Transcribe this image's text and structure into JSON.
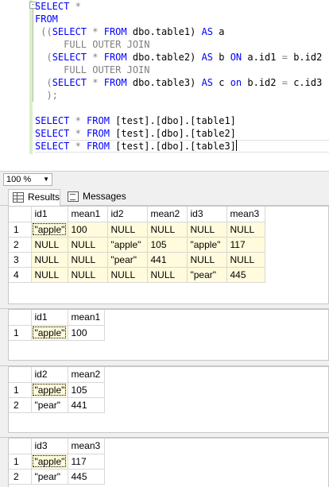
{
  "editor": {
    "lines": [
      [
        {
          "t": "SELECT",
          "c": "k"
        },
        {
          "t": " *",
          "c": "g"
        }
      ],
      [
        {
          "t": "FROM",
          "c": "k"
        }
      ],
      [
        {
          "t": " ((",
          "c": "g"
        },
        {
          "t": "SELECT",
          "c": "k"
        },
        {
          "t": " * ",
          "c": "g"
        },
        {
          "t": "FROM",
          "c": "k"
        },
        {
          "t": " dbo.table1) ",
          "c": ""
        },
        {
          "t": "AS",
          "c": "k"
        },
        {
          "t": " a",
          "c": ""
        }
      ],
      [
        {
          "t": "     ",
          "c": ""
        },
        {
          "t": "FULL OUTER JOIN",
          "c": "g"
        }
      ],
      [
        {
          "t": "  (",
          "c": "g"
        },
        {
          "t": "SELECT",
          "c": "k"
        },
        {
          "t": " * ",
          "c": "g"
        },
        {
          "t": "FROM",
          "c": "k"
        },
        {
          "t": " dbo.table2) ",
          "c": ""
        },
        {
          "t": "AS",
          "c": "k"
        },
        {
          "t": " b ",
          "c": ""
        },
        {
          "t": "ON",
          "c": "k"
        },
        {
          "t": " a.id1 ",
          "c": ""
        },
        {
          "t": "=",
          "c": "g"
        },
        {
          "t": " b.id2",
          "c": ""
        }
      ],
      [
        {
          "t": "     ",
          "c": ""
        },
        {
          "t": "FULL OUTER JOIN",
          "c": "g"
        }
      ],
      [
        {
          "t": "  (",
          "c": "g"
        },
        {
          "t": "SELECT",
          "c": "k"
        },
        {
          "t": " * ",
          "c": "g"
        },
        {
          "t": "FROM",
          "c": "k"
        },
        {
          "t": " dbo.table3) ",
          "c": ""
        },
        {
          "t": "AS",
          "c": "k"
        },
        {
          "t": " c ",
          "c": ""
        },
        {
          "t": "on",
          "c": "k"
        },
        {
          "t": " b.id2 ",
          "c": ""
        },
        {
          "t": "=",
          "c": "g"
        },
        {
          "t": " c.id3",
          "c": ""
        }
      ],
      [
        {
          "t": "  );",
          "c": "g"
        }
      ],
      [],
      [
        {
          "t": "SELECT",
          "c": "k"
        },
        {
          "t": " * ",
          "c": "g"
        },
        {
          "t": "FROM",
          "c": "k"
        },
        {
          "t": " [test].[dbo].[table1]",
          "c": ""
        }
      ],
      [
        {
          "t": "SELECT",
          "c": "k"
        },
        {
          "t": " * ",
          "c": "g"
        },
        {
          "t": "FROM",
          "c": "k"
        },
        {
          "t": " [test].[dbo].[table2]",
          "c": ""
        }
      ],
      [
        {
          "t": "SELECT",
          "c": "k"
        },
        {
          "t": " * ",
          "c": "g"
        },
        {
          "t": "FROM",
          "c": "k"
        },
        {
          "t": " [test].[dbo].[table3]",
          "c": ""
        }
      ]
    ],
    "fold_symbol": "-"
  },
  "zoom": {
    "value": "100 %"
  },
  "tabs": {
    "results": "Results",
    "messages": "Messages"
  },
  "grids": [
    {
      "columns": [
        "id1",
        "mean1",
        "id2",
        "mean2",
        "id3",
        "mean3"
      ],
      "rows": [
        {
          "num": "1",
          "cells": [
            "\"apple\"",
            "100",
            "NULL",
            "NULL",
            "NULL",
            "NULL"
          ]
        },
        {
          "num": "2",
          "cells": [
            "NULL",
            "NULL",
            "\"apple\"",
            "105",
            "\"apple\"",
            "117"
          ]
        },
        {
          "num": "3",
          "cells": [
            "NULL",
            "NULL",
            "\"pear\"",
            "441",
            "NULL",
            "NULL"
          ]
        },
        {
          "num": "4",
          "cells": [
            "NULL",
            "NULL",
            "NULL",
            "NULL",
            "\"pear\"",
            "445"
          ]
        }
      ]
    },
    {
      "columns": [
        "id1",
        "mean1"
      ],
      "rows": [
        {
          "num": "1",
          "cells": [
            "\"apple\"",
            "100"
          ]
        }
      ]
    },
    {
      "columns": [
        "id2",
        "mean2"
      ],
      "rows": [
        {
          "num": "1",
          "cells": [
            "\"apple\"",
            "105"
          ]
        },
        {
          "num": "2",
          "cells": [
            "\"pear\"",
            "441"
          ]
        }
      ]
    },
    {
      "columns": [
        "id3",
        "mean3"
      ],
      "rows": [
        {
          "num": "1",
          "cells": [
            "\"apple\"",
            "117"
          ]
        },
        {
          "num": "2",
          "cells": [
            "\"pear\"",
            "445"
          ]
        }
      ]
    }
  ]
}
